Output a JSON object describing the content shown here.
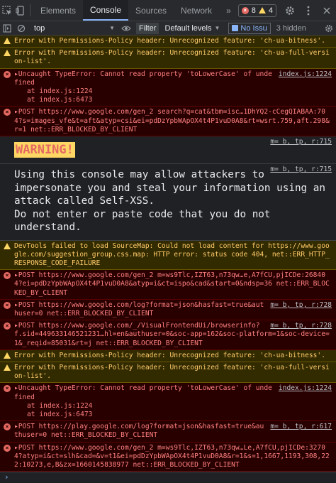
{
  "toolbar": {
    "tabs": [
      "Elements",
      "Console",
      "Sources",
      "Network"
    ],
    "more": "»",
    "error_count": "8",
    "warn_count": "4"
  },
  "filterbar": {
    "context": "top",
    "filter_label": "Filter",
    "levels": "Default levels",
    "issues": "No Issu",
    "hidden": "3 hidden"
  },
  "messages": [
    {
      "kind": "warn",
      "text": "Error with Permissions-Policy header: Unrecognized feature: 'ch-ua-bitness'."
    },
    {
      "kind": "warn",
      "text": "Error with Permissions-Policy header: Unrecognized feature: 'ch-ua-full-version-list'."
    },
    {
      "kind": "err",
      "source": "index.js:1224",
      "text": "▸Uncaught TypeError: Cannot read property 'toLowerCase' of undefined",
      "trace": [
        "at index.js:1224",
        "at index.js:6473"
      ]
    },
    {
      "kind": "err",
      "text": "▸POST https://www.google.com/gen_2 search?q=cat&tbm=isc…1DhYQ2-cCegQIABAA:704?s=images_vfe&t=aft&atyp=csi&ei=pdDzYpbWApOX4t4P1vuD0A8&rt=wsrt.759,aft.298&r=1 net::ERR_BLOCKED_BY_CLIENT"
    },
    {
      "kind": "warning_banner",
      "source": "m= b, tp, r:715",
      "text": "WARNING!"
    },
    {
      "kind": "selfxss",
      "source": "m= b, tp, r:715",
      "text": "Using this console may allow attackers to impersonate you and steal your information using an attack called Self-XSS.\nDo not enter or paste code that you do not understand."
    },
    {
      "kind": "warn",
      "text": "DevTools failed to load SourceMap: Could not load content for https://www.google.com/suggestion_group.css.map: HTTP error: status code 404, net::ERR_HTTP_RESPONSE_CODE_FAILURE"
    },
    {
      "kind": "err",
      "text": "▸POST https://www.google.com/gen_2 m=ws9Tlc,IZT63,n73qw…e,A7fCU,pjICDe:268404?ei=pdDzYpbWApOX4t4P1vuD0A8&atyp=i&ct=ispo&cad&start=0&ndsp=36 net::ERR_BLOCKED_BY_CLIENT"
    },
    {
      "kind": "err",
      "source": "m= b, tp, r:728",
      "text": "▸POST https://www.google.com/log?format=json&hasfast=true&authuser=0 net::ERR_BLOCKED_BY_CLIENT"
    },
    {
      "kind": "err",
      "source": "m= b, tp, r:728",
      "text": "▸POST https://www.google.com/_/VisualFrontendUi/browserinfo?f.sid=449633146521231…hl=en&authuser=0&soc-app=162&soc-platform=1&soc-device=1&_reqid=85031&rt=j net::ERR_BLOCKED_BY_CLIENT"
    },
    {
      "kind": "warn",
      "text": "Error with Permissions-Policy header: Unrecognized feature: 'ch-ua-bitness'."
    },
    {
      "kind": "warn",
      "text": "Error with Permissions-Policy header: Unrecognized feature: 'ch-ua-full-version-list'."
    },
    {
      "kind": "err",
      "source": "index.js:1224",
      "text": "▸Uncaught TypeError: Cannot read property 'toLowerCase' of undefined",
      "trace": [
        "at index.js:1224",
        "at index.js:6473"
      ]
    },
    {
      "kind": "err",
      "source": "m= b, tp, r:617",
      "text": "▸POST https://play.google.com/log?format=json&hasfast=true&authuser=0 net::ERR_BLOCKED_BY_CLIENT"
    },
    {
      "kind": "err",
      "text": "▸POST https://www.google.com/gen_2 m=ws9Tlc,IZT63,n73qw…Le,A7fCU,pjICDe:32704?atyp=i&ct=slh&cad=&v=t1&ei=pdDzYpbWApOX4t4P1vuD0A8&r=1&s=1,1667,1193,308,222:10273,e,B&zx=1660145838977 net::ERR_BLOCKED_BY_CLIENT"
    }
  ],
  "prompt": "›",
  "colors": {
    "error_bg": "#290000",
    "warn_bg": "#332b00",
    "accent": "#8ab4f8"
  }
}
